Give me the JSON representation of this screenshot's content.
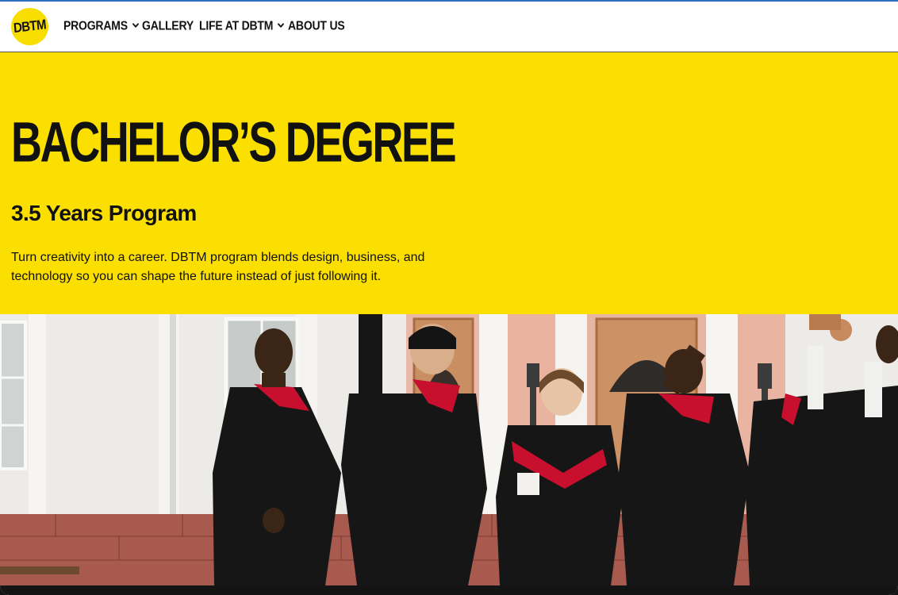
{
  "logo": {
    "text": "DBTM"
  },
  "nav": {
    "programs": "PROGRAMS",
    "gallery": "GALLERY",
    "life": "LIFE AT DBTM",
    "about": "ABOUT US"
  },
  "hero": {
    "title": "BACHELOR’S DEGREE",
    "subtitle": "3.5 Years Program",
    "description": "Turn creativity into a career. DBTM program blends design, business, and technology so you can shape the future instead of just following it."
  },
  "colors": {
    "brand_yellow": "#fadf00",
    "text_dark": "#111111",
    "gown_black": "#161616",
    "hood_red": "#c8102e"
  },
  "icons": {
    "dropdown": "chevron-down-icon"
  }
}
